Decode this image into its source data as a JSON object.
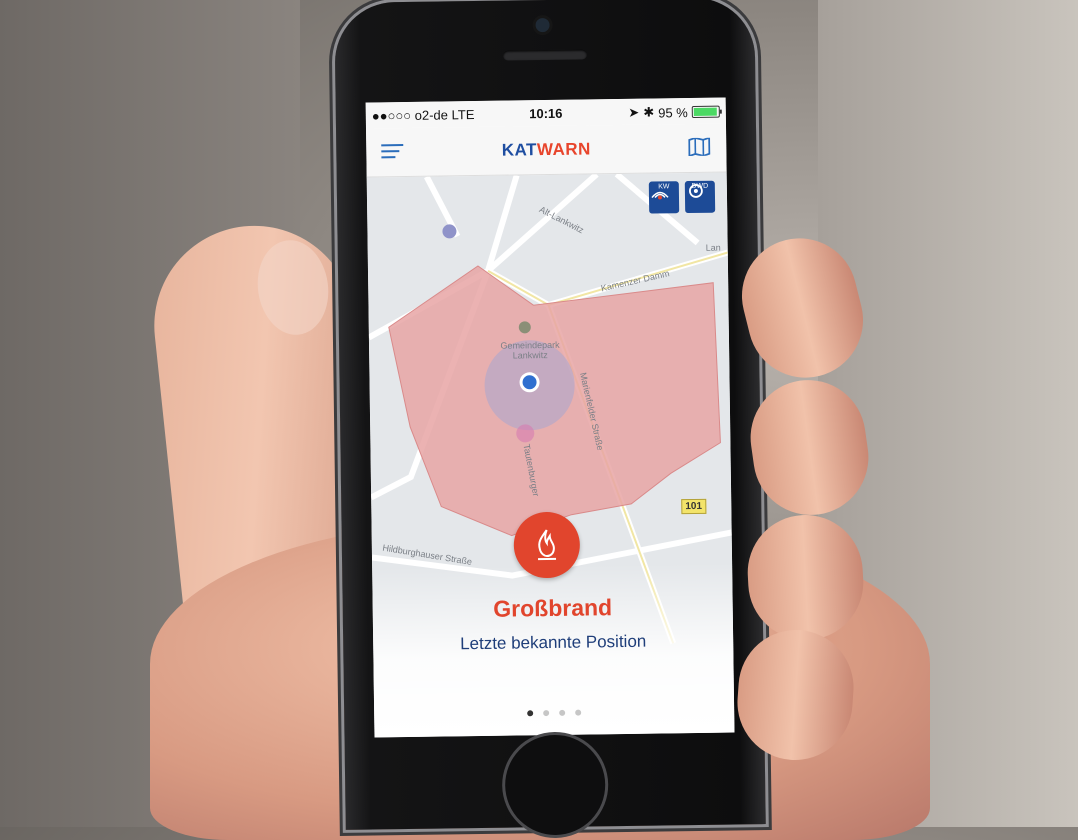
{
  "status_bar": {
    "carrier": "●●○○○ o2-de  LTE",
    "time": "10:16",
    "battery": "95 %"
  },
  "navbar": {
    "brand_part1": "KAT",
    "brand_part2": "WARN"
  },
  "map": {
    "layers": [
      {
        "label": "KW"
      },
      {
        "label": "DWD"
      }
    ],
    "street_labels": [
      "Alt-Lankwitz",
      "Kamenzer Damm",
      "Gemeindepark Lankwitz",
      "Marienfelder Straße",
      "Hildburghauser Straße",
      "Tautenburger",
      "Lan"
    ],
    "road_badge": "101"
  },
  "alert": {
    "title": "Großbrand",
    "subtitle": "Letzte bekannte Position"
  },
  "pager": {
    "count": 4,
    "active_index": 0
  },
  "colors": {
    "brand_blue": "#1f4ea1",
    "brand_red": "#e8452c",
    "alert_red": "#e1452d",
    "zone_fill": "#e7a5a4",
    "location_dot": "#2f6fd0"
  },
  "icons": {
    "menu": "menu-icon",
    "map": "map-book-icon",
    "alert": "fire-icon"
  }
}
